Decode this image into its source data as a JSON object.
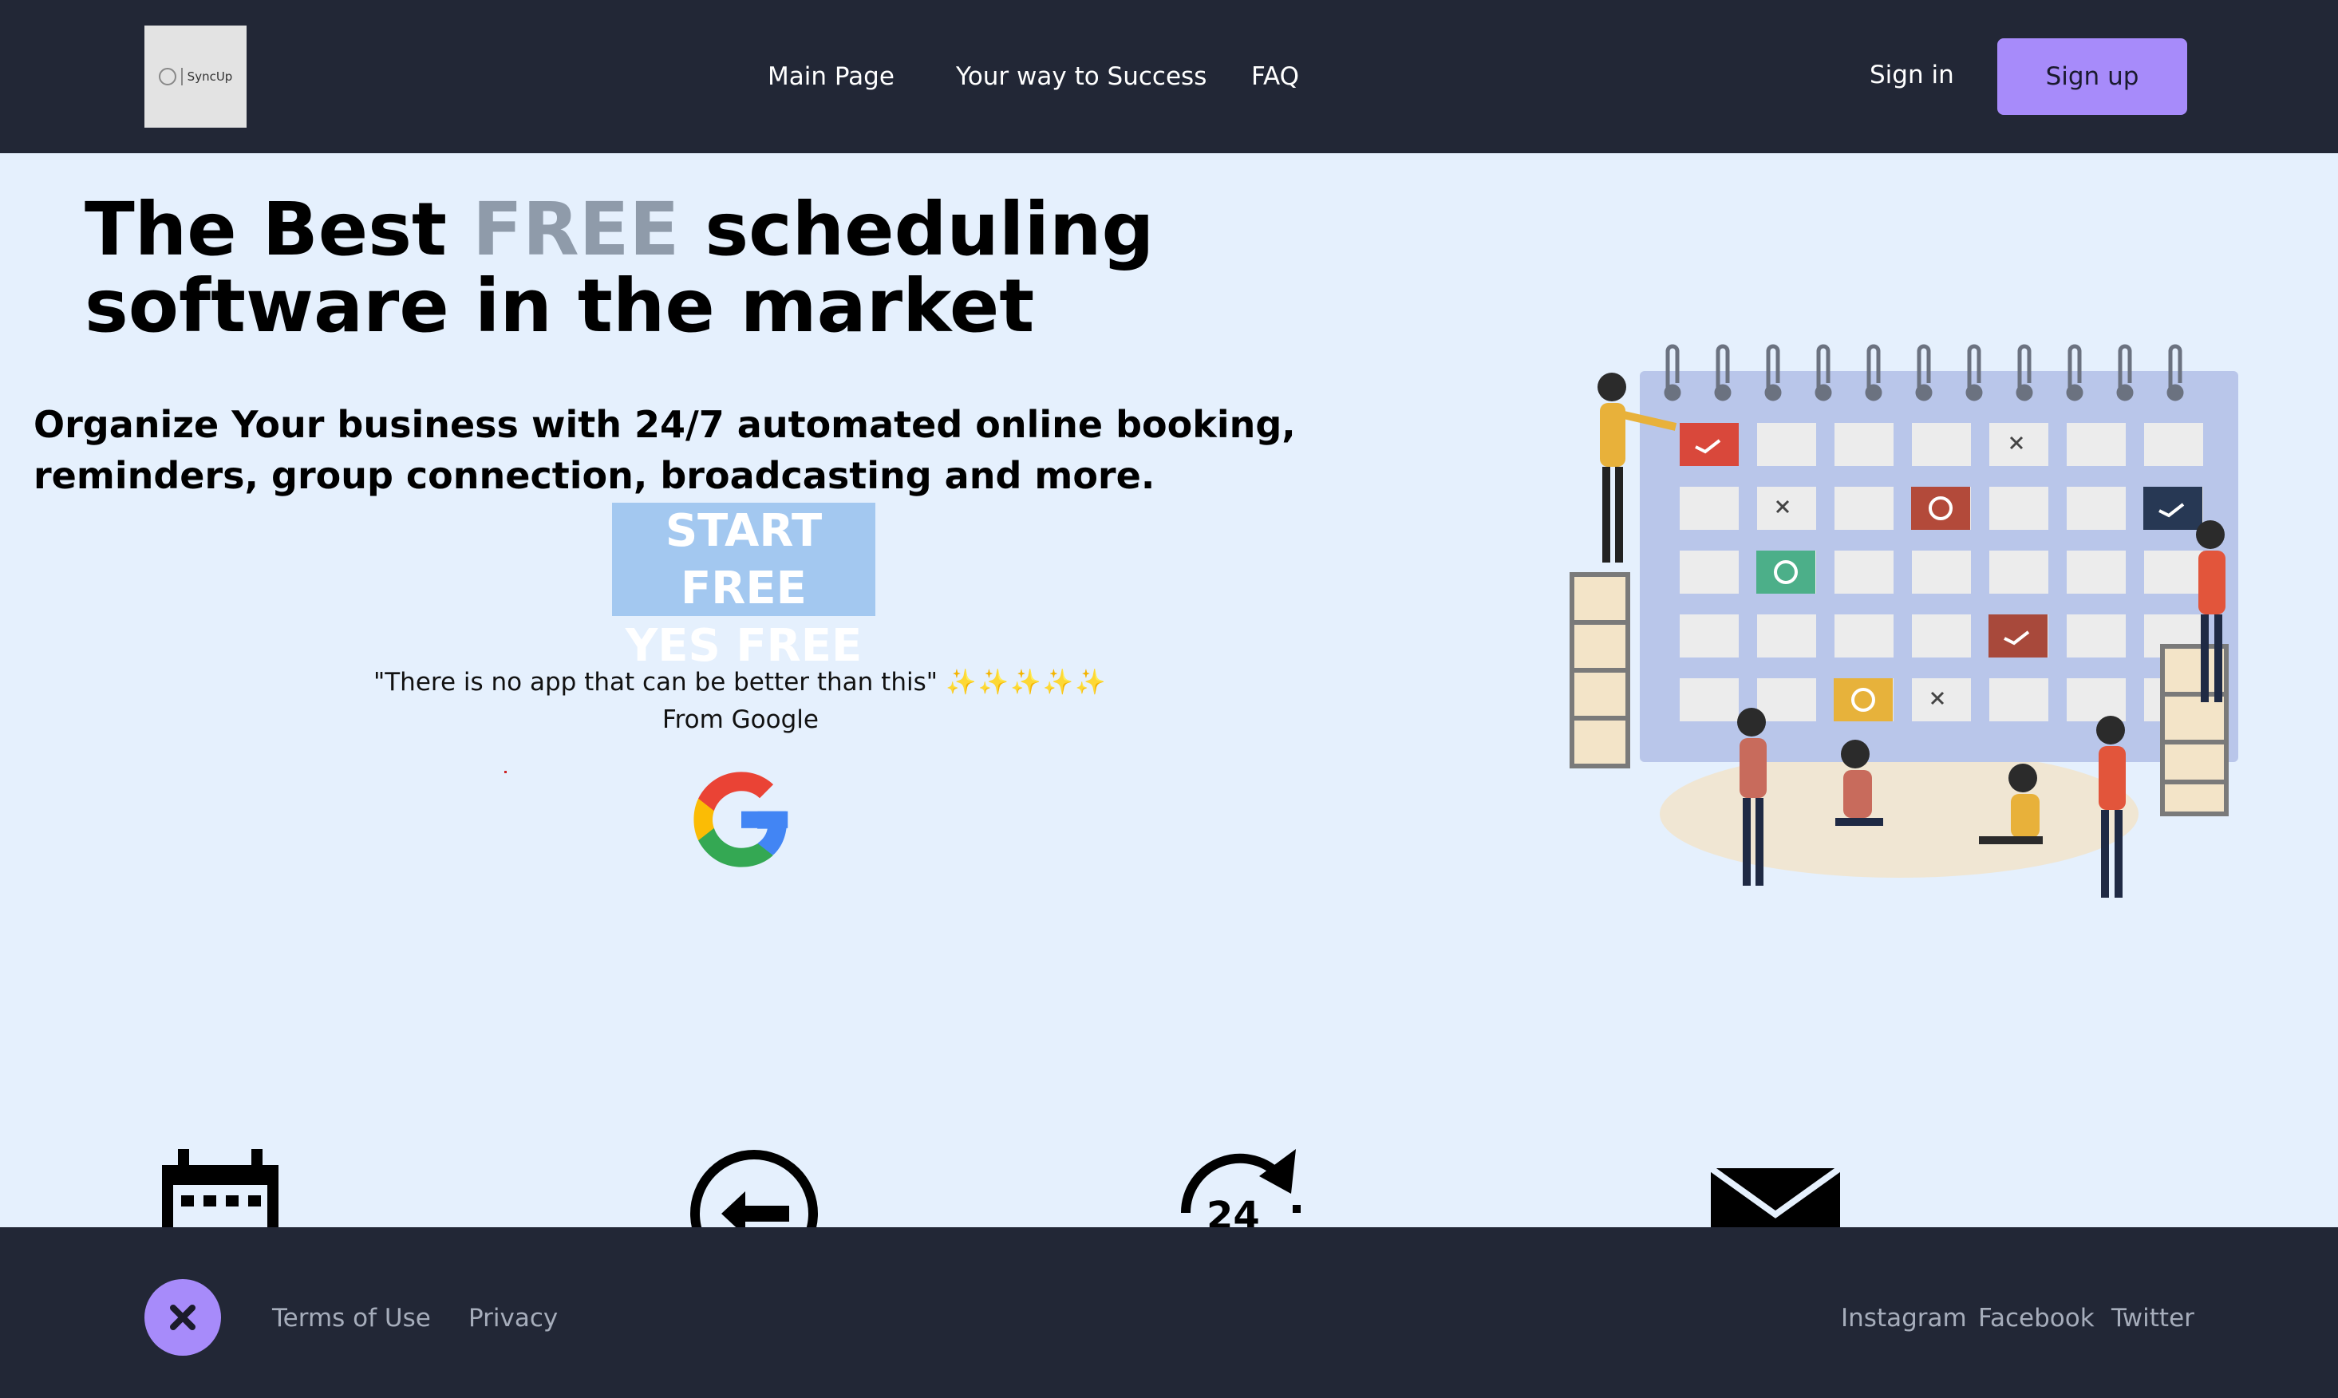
{
  "header": {
    "logo_text": "SyncUp",
    "nav": [
      {
        "label": "Main Page"
      },
      {
        "label": "Your way to Success"
      },
      {
        "label": "FAQ"
      }
    ],
    "signin_label": "Sign in",
    "signup_label": "Sign up"
  },
  "hero": {
    "title_prefix": "The Best ",
    "title_highlight": "FREE",
    "title_suffix": " scheduling software in the market",
    "subtitle": "Organize Your business with 24/7 automated online booking, reminders, group connection, broadcasting and more.",
    "cta_line1": "START FREE",
    "cta_line2": "YES FREE",
    "quote": "\"There is no app that can be better than this\"",
    "quote_stars": "✨✨✨✨✨",
    "quote_source": "From Google"
  },
  "features": {
    "icons": [
      "calendar-icon",
      "logout-arrow-icon",
      "24-hours-icon",
      "envelope-icon"
    ]
  },
  "footer": {
    "badge_icon": "close-icon",
    "links_left": [
      {
        "label": "Terms of Use"
      },
      {
        "label": "Privacy"
      }
    ],
    "links_right": [
      {
        "label": "Instagram"
      },
      {
        "label": "Facebook"
      },
      {
        "label": "Twitter"
      }
    ]
  },
  "colors": {
    "nav_bg": "#222736",
    "page_bg": "#e5f0fd",
    "accent": "#a78bfa",
    "cta_bg": "#a3c8f0",
    "free_text": "#8f9baa"
  }
}
